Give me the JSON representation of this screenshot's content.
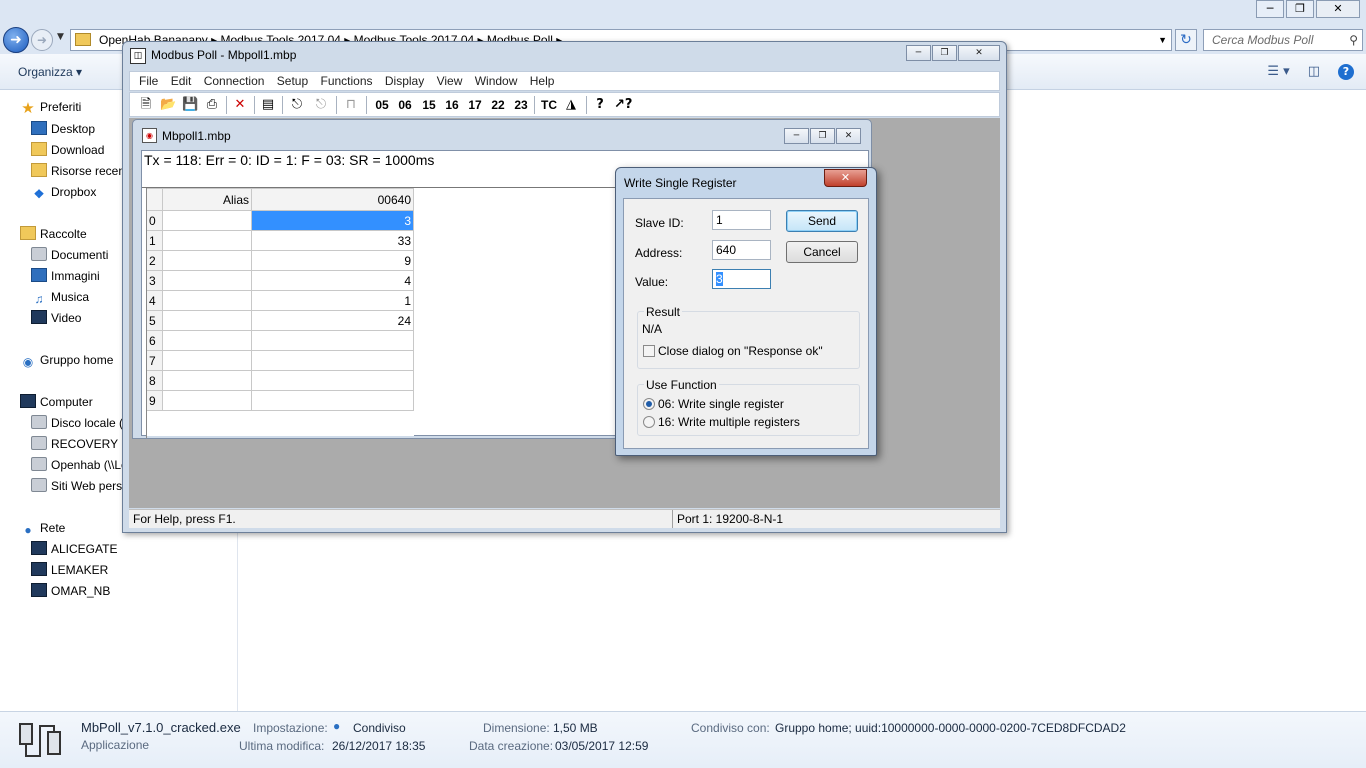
{
  "explorer": {
    "breadcrumb": "OpenHab Bananapy  ▸  Modbus Tools 2017.04  ▸  Modbus Tools 2017.04  ▸  Modbus Poll  ▸",
    "search_placeholder": "Cerca Modbus Poll",
    "organize_label": "Organizza ▾",
    "nav": {
      "favorites": "Preferiti",
      "desktop": "Desktop",
      "download": "Download",
      "recent": "Risorse recenti",
      "dropbox": "Dropbox",
      "libraries": "Raccolte",
      "documents": "Documenti",
      "images": "Immagini",
      "music": "Musica",
      "video": "Video",
      "homegroup": "Gruppo home",
      "computer": "Computer",
      "local_disk": "Disco locale (C:)",
      "recovery": "RECOVERY (D:)",
      "openhab": "Openhab (\\\\LeMaker)",
      "websites": "Siti Web personali",
      "network": "Rete",
      "net1": "ALICEGATE",
      "net2": "LEMAKER",
      "net3": "OMAR_NB"
    },
    "details": {
      "file_name": "MbPoll_v7.1.0_cracked.exe",
      "file_type": "Applicazione",
      "setting_label": "Impostazione:",
      "setting_value": "Condiviso",
      "modified_label": "Ultima modifica:",
      "modified_value": "26/12/2017 18:35",
      "size_label": "Dimensione:",
      "size_value": "1,50 MB",
      "created_label": "Data creazione:",
      "created_value": "03/05/2017 12:59",
      "shared_label": "Condiviso con:",
      "shared_value": "Gruppo home; uuid:10000000-0000-0000-0200-7CED8DFCDAD2"
    }
  },
  "modbus": {
    "title": "Modbus Poll - Mbpoll1.mbp",
    "menu": [
      "File",
      "Edit",
      "Connection",
      "Setup",
      "Functions",
      "Display",
      "View",
      "Window",
      "Help"
    ],
    "toolbar_codes": [
      "05",
      "06",
      "15",
      "16",
      "17",
      "22",
      "23"
    ],
    "toolbar_tc": "TC",
    "status_left": "For Help, press F1.",
    "status_right": "Port 1: 19200-8-N-1",
    "child": {
      "title": "Mbpoll1.mbp",
      "tx_info": "Tx = 118: Err = 0: ID = 1: F = 03: SR = 1000ms",
      "col_alias": "Alias",
      "col_address": "00640",
      "rows": [
        {
          "idx": "0",
          "value": "3",
          "selected": true
        },
        {
          "idx": "1",
          "value": "33"
        },
        {
          "idx": "2",
          "value": "9"
        },
        {
          "idx": "3",
          "value": "4"
        },
        {
          "idx": "4",
          "value": "1"
        },
        {
          "idx": "5",
          "value": "24"
        },
        {
          "idx": "6",
          "value": ""
        },
        {
          "idx": "7",
          "value": ""
        },
        {
          "idx": "8",
          "value": ""
        },
        {
          "idx": "9",
          "value": ""
        }
      ]
    }
  },
  "dialog": {
    "title": "Write Single Register",
    "slave_label": "Slave ID:",
    "slave_value": "1",
    "address_label": "Address:",
    "address_value": "640",
    "value_label": "Value:",
    "value_value": "3",
    "send": "Send",
    "cancel": "Cancel",
    "result_label": "Result",
    "result_value": "N/A",
    "close_on_ok": "Close dialog on \"Response ok\"",
    "use_function_label": "Use Function",
    "fn06": "06: Write single register",
    "fn16": "16: Write multiple registers"
  }
}
